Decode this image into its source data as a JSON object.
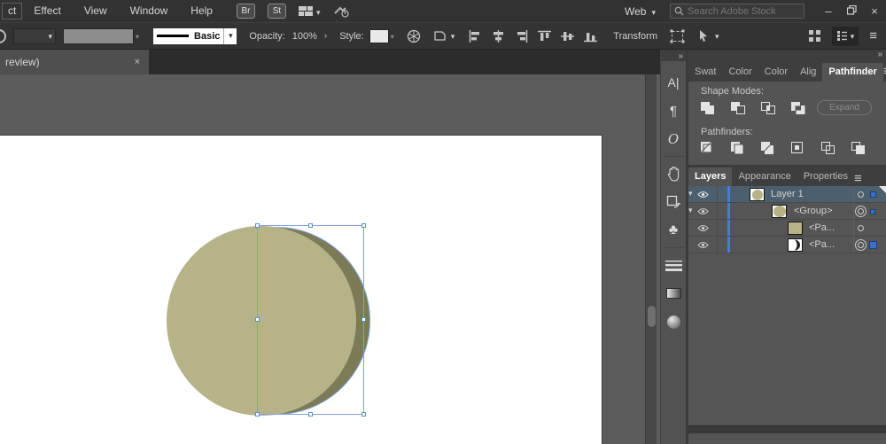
{
  "menubar": {
    "items": [
      "ct",
      "Effect",
      "View",
      "Window",
      "Help"
    ],
    "br_button": "Br",
    "st_button": "St",
    "doc_profile": "Web",
    "search_placeholder": "Search Adobe Stock"
  },
  "controlbar": {
    "stroke_style": "Basic",
    "opacity_label": "Opacity:",
    "opacity_value": "100%",
    "style_label": "Style:",
    "transform_label": "Transform",
    "align_buttons": [
      "align-left",
      "align-center",
      "align-right",
      "align-top",
      "align-middle",
      "align-bottom"
    ]
  },
  "document_tab": {
    "title": "review)",
    "close_glyph": "×"
  },
  "icon_strip": {
    "panels": [
      "character",
      "paragraph",
      "opentype",
      "libraries-hand",
      "artboards",
      "symbols",
      "stroke",
      "gradient",
      "color-sphere"
    ]
  },
  "panel_dock": {
    "pathfinder": {
      "tabs": [
        "Swat",
        "Color",
        "Color",
        "Alig",
        "Pathfinder"
      ],
      "active_tab": "Pathfinder",
      "shape_modes_label": "Shape Modes:",
      "shape_mode_buttons": [
        "unite",
        "minus-front",
        "intersect",
        "exclude"
      ],
      "expand_button": "Expand",
      "pathfinders_label": "Pathfinders:",
      "pathfinder_buttons": [
        "divide",
        "trim",
        "merge",
        "crop",
        "outline",
        "minus-back"
      ]
    },
    "layers": {
      "tabs": [
        "Layers",
        "Appearance",
        "Properties"
      ],
      "active_tab": "Layers",
      "rows": [
        {
          "name": "Layer 1",
          "selected": true
        },
        {
          "name": "<Group>"
        },
        {
          "name": "<Pa..."
        },
        {
          "name": "<Pa..."
        }
      ]
    }
  },
  "canvas": {
    "artboard_color": "#ffffff",
    "shape_fill": "#b6b388",
    "shape_shadow_fill": "#7c7a57",
    "selection_color": "#7da2d8"
  }
}
